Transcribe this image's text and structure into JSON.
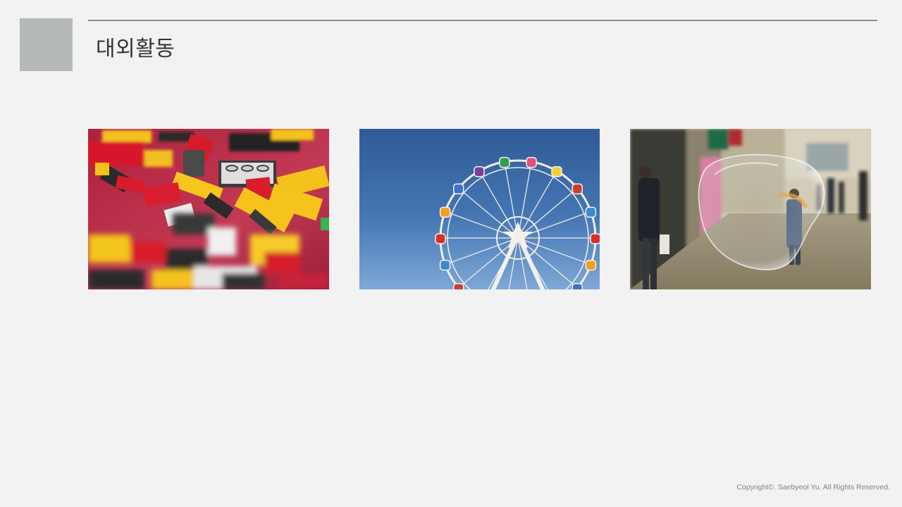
{
  "slide": {
    "title": "대외활동",
    "copyright": "Copyright©. Saebyeol Yu. All Rights Reserved."
  },
  "colors": {
    "background": "#f2f2f2",
    "accent_square": "#b5b9b8",
    "title_rule": "#8c8c8c",
    "title_text": "#333333",
    "footer_text": "#808080"
  },
  "photos": [
    {
      "subject": "scattered colorful toy building bricks on a red surface"
    },
    {
      "subject": "ferris wheel against a blue sky"
    },
    {
      "subject": "street scene with a large soap bubble"
    }
  ]
}
